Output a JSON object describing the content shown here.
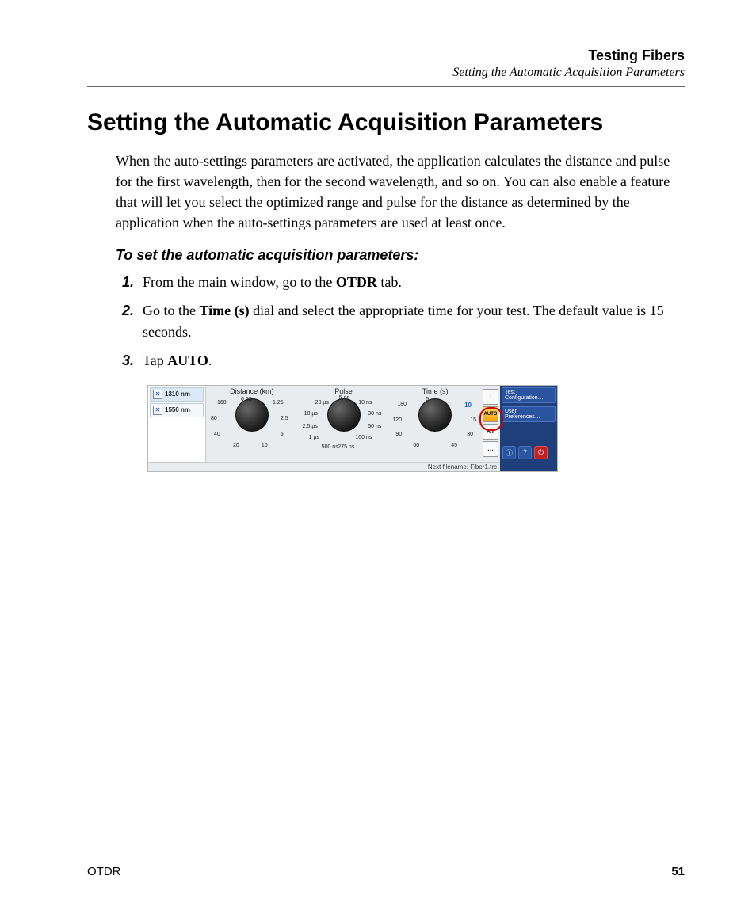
{
  "header": {
    "title": "Testing Fibers",
    "subtitle": "Setting the Automatic Acquisition Parameters"
  },
  "section_heading": "Setting the Automatic Acquisition Parameters",
  "intro_paragraph": "When the auto-settings parameters are activated, the application calculates the distance and pulse for the first wavelength, then for the second wavelength, and so on. You can also enable a feature that will let you select the optimized range and pulse for the distance as determined by the application when the auto-settings parameters are used at least once.",
  "instructions_heading": "To set the automatic acquisition parameters:",
  "steps": {
    "s1_pre": "From the main window, go to the ",
    "s1_bold": "OTDR",
    "s1_post": " tab.",
    "s2_pre": "Go to the ",
    "s2_bold": "Time (s)",
    "s2_post": " dial and select the appropriate time for your test. The default value is 15 seconds.",
    "s3_pre": "Tap ",
    "s3_bold": "AUTO",
    "s3_post": "."
  },
  "figure": {
    "wavelengths": [
      "1310 nm",
      "1550 nm"
    ],
    "dials": {
      "distance": {
        "title": "Distance (km)",
        "ticks": [
          "0.63",
          "1.25",
          "2.5",
          "5",
          "10",
          "20",
          "40",
          "80",
          "160"
        ]
      },
      "pulse": {
        "title": "Pulse",
        "ticks": [
          "5 ns",
          "10 ns",
          "30 ns",
          "50 ns",
          "100 ns",
          "275 ns",
          "500 ns",
          "1 µs",
          "2.5 µs",
          "10 µs",
          "20 µs"
        ]
      },
      "time": {
        "title": "Time (s)",
        "ticks": [
          "5",
          "10",
          "15",
          "30",
          "45",
          "60",
          "90",
          "120",
          "180"
        ],
        "selected": "10"
      }
    },
    "side_buttons": {
      "arrow": "↓",
      "auto": "AUTO",
      "rt": "RT",
      "more": "…"
    },
    "menu": {
      "test_config": "Test Configuration…",
      "user_prefs": "User Preferences…"
    },
    "status": "Next filename: Fiber1.trc"
  },
  "footer": {
    "left": "OTDR",
    "right": "51"
  }
}
